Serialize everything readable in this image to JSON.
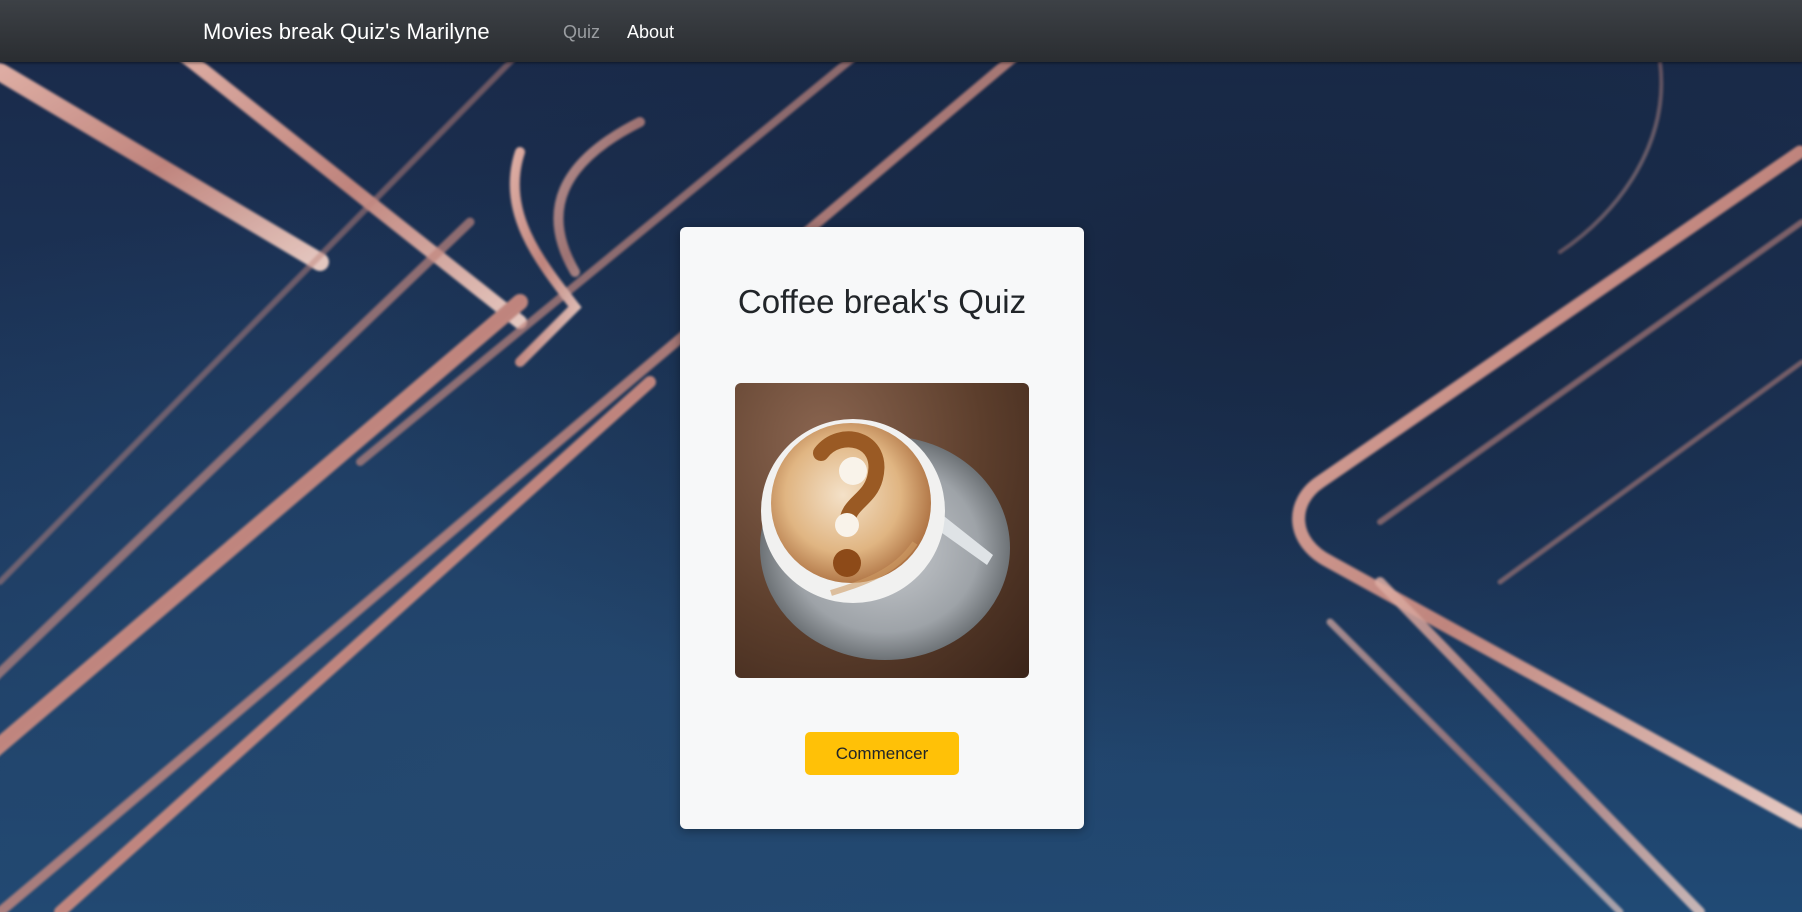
{
  "navbar": {
    "brand": "Movies break Quiz's Marilyne",
    "links": [
      {
        "label": "Quiz",
        "active": false
      },
      {
        "label": "About",
        "active": true
      }
    ]
  },
  "card": {
    "title": "Coffee break's Quiz",
    "image_icon": "coffee-question-mark-icon",
    "start_button": "Commencer"
  },
  "colors": {
    "navbar_bg": "#343a40",
    "card_bg": "#f7f8f9",
    "button_bg": "#ffc107",
    "background_navy": "#1b2d4e",
    "ribbon_copper": "#d6948a"
  }
}
